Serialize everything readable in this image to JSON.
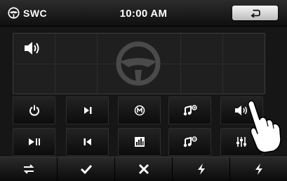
{
  "header": {
    "logo_text": "SWC",
    "logo_icon": "steering-wheel-icon",
    "time": "10:00 AM",
    "back_icon": "return-arrow-icon"
  },
  "panel": {
    "volume_icon": "speaker-volume-icon",
    "center_icon": "steering-wheel-icon"
  },
  "buttons": [
    {
      "name": "power",
      "icon": "power-icon"
    },
    {
      "name": "next-track",
      "icon": "skip-next-icon"
    },
    {
      "name": "mode",
      "icon": "mode-m-icon"
    },
    {
      "name": "music-up",
      "icon": "music-note-plus-icon"
    },
    {
      "name": "volume-up",
      "icon": "volume-up-icon"
    },
    {
      "name": "play-pause",
      "icon": "play-pause-icon"
    },
    {
      "name": "previous-track",
      "icon": "skip-previous-icon"
    },
    {
      "name": "equalizer",
      "icon": "bar-chart-icon"
    },
    {
      "name": "music-down",
      "icon": "music-note-minus-icon"
    },
    {
      "name": "eq-settings",
      "icon": "sliders-icon"
    }
  ],
  "bottom_bar": [
    {
      "name": "swap",
      "icon": "swap-arrows-icon"
    },
    {
      "name": "confirm",
      "icon": "check-icon"
    },
    {
      "name": "cancel",
      "icon": "cross-icon"
    },
    {
      "name": "lightning-1",
      "icon": "lightning-icon"
    },
    {
      "name": "lightning-2",
      "icon": "lightning-icon"
    }
  ]
}
